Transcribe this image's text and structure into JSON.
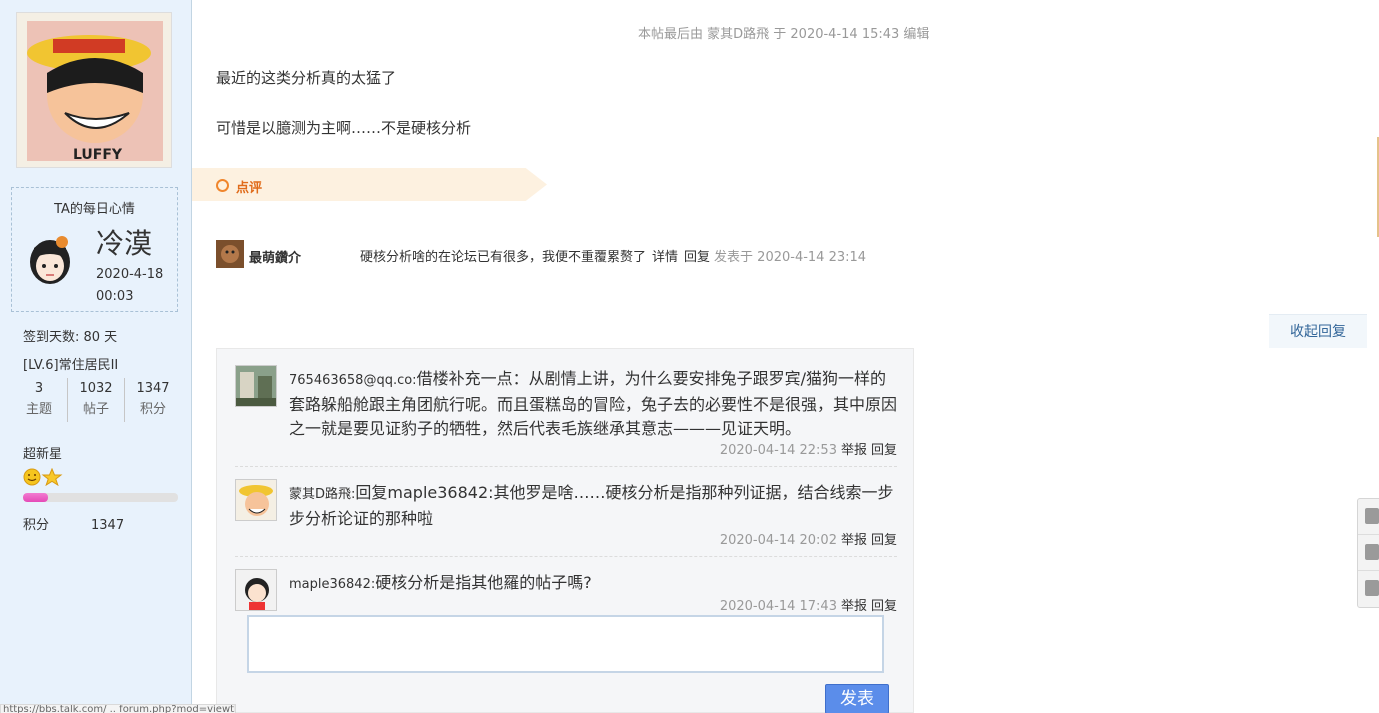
{
  "sidebar": {
    "mood_title": "TA的每日心情",
    "mood_word": "冷漠",
    "mood_date": "2020-4-18",
    "mood_time": "00:03",
    "checkin": "签到天数: 80 天",
    "level": "[LV.6]常住居民II",
    "stats": [
      {
        "num": "3",
        "label": "主题"
      },
      {
        "num": "1032",
        "label": "帖子"
      },
      {
        "num": "1347",
        "label": "积分"
      }
    ],
    "rank_title": "超新星",
    "progress_fraction": 0.16,
    "points_label": "积分",
    "points_value": "1347"
  },
  "post": {
    "edit_note": "本帖最后由 蒙其D路飛 于 2020-4-14 15:43 编辑",
    "line1": "最近的这类分析真的太猛了",
    "line2": "可惜是以臆测为主啊……不是硬核分析"
  },
  "comment_bar": {
    "label": "点评"
  },
  "comment": {
    "user": "最萌鑽介",
    "text": "硬核分析啥的在论坛已有很多，我便不重覆累赘了",
    "detail": "详情",
    "reply": "回复",
    "time": "发表于 2020-4-14 23:14"
  },
  "collapse_label": "收起回复",
  "replies": [
    {
      "who": "765463658@qq.co:",
      "text": "借楼补充一点：从剧情上讲，为什么要安排兔子跟罗宾/猫狗一样的套路躲船舱跟主角团航行呢。而且蛋糕岛的冒险，兔子去的必要性不是很强，其中原因之一就是要见证豹子的牺牲，然后代表毛族继承其意志———见证天明。",
      "time": "2020-04-14 22:53",
      "report": "举报",
      "reply": "回复"
    },
    {
      "who": "蒙其D路飛:",
      "text": "回复maple36842:其他罗是啥……硬核分析是指那种列证据，结合线索一步步分析论证的那种啦",
      "time": "2020-04-14 20:02",
      "report": "举报",
      "reply": "回复"
    },
    {
      "who": "maple36842:",
      "text": "硬核分析是指其他羅的帖子嗎?",
      "time": "2020-04-14 17:43",
      "report": "举报",
      "reply": "回复"
    }
  ],
  "send_label": "发表",
  "status_url": "https://bbs.talk.com/ .. forum.php?mod=viewthread&tid=159562.html"
}
